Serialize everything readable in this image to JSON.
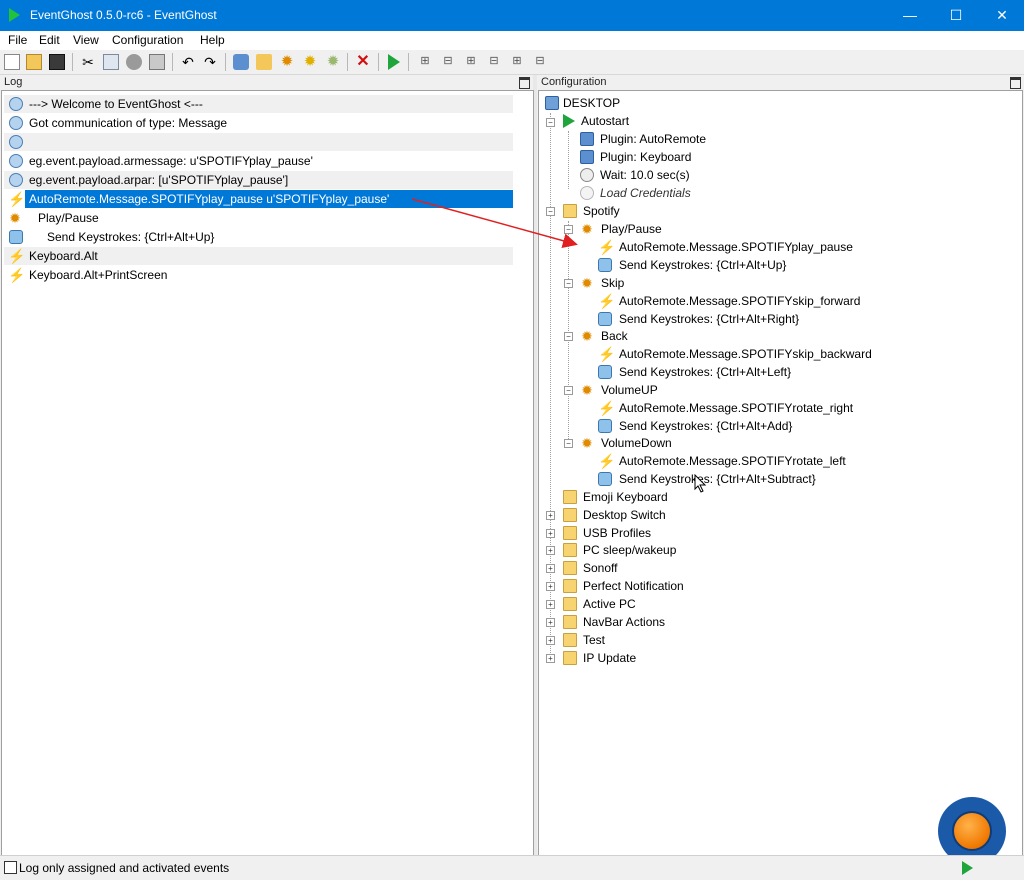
{
  "window": {
    "title": "EventGhost 0.5.0-rc6 - EventGhost",
    "min_label": "—",
    "max_label": "☐",
    "close_label": "✕"
  },
  "menu": [
    "File",
    "Edit",
    "View",
    "Configuration",
    "Help"
  ],
  "toolbar_icons": [
    "new-icon",
    "open-icon",
    "save-icon",
    "cut-icon",
    "copy-icon",
    "python-icon",
    "paste-icon",
    "undo-icon",
    "redo-icon",
    "add-plugin-icon",
    "add-folder-icon",
    "add-macro-icon",
    "add-event-icon",
    "add-action-icon",
    "delete-icon",
    "execute-icon",
    "expand-icon",
    "collapse-icon",
    "expand-children-icon",
    "collapse-children-icon",
    "expand-all-icon",
    "collapse-all-icon"
  ],
  "log": {
    "header": "Log",
    "rows": [
      {
        "icon": "message",
        "text": "---> Welcome to EventGhost <---"
      },
      {
        "icon": "message",
        "text": "Got communication of type: Message"
      },
      {
        "icon": "message",
        "text": ""
      },
      {
        "icon": "message",
        "text": "eg.event.payload.armessage: u'SPOTIFYplay_pause'"
      },
      {
        "icon": "message",
        "text": "eg.event.payload.arpar: [u'SPOTIFYplay_pause']"
      },
      {
        "icon": "event",
        "text": "AutoRemote.Message.SPOTIFYplay_pause u'SPOTIFYplay_pause'"
      },
      {
        "icon": "macro",
        "text": "Play/Pause"
      },
      {
        "icon": "keyboard",
        "text": "Send Keystrokes: {Ctrl+Alt+Up}"
      },
      {
        "icon": "event",
        "text": "Keyboard.Alt"
      },
      {
        "icon": "event",
        "text": "Keyboard.Alt+PrintScreen"
      }
    ],
    "selected_index": 5
  },
  "config": {
    "header": "Configuration",
    "root": "DESKTOP",
    "autostart": {
      "label": "Autostart",
      "items": [
        {
          "icon": "plugin",
          "text": "Plugin: AutoRemote"
        },
        {
          "icon": "plugin",
          "text": "Plugin: Keyboard"
        },
        {
          "icon": "clock",
          "text": "Wait: 10.0 sec(s)"
        },
        {
          "icon": "clock",
          "text": "Load Credentials",
          "disabled": true
        }
      ]
    },
    "spotify": {
      "label": "Spotify",
      "macros": [
        {
          "label": "Play/Pause",
          "event": "AutoRemote.Message.SPOTIFYplay_pause",
          "action": "Send Keystrokes: {Ctrl+Alt+Up}"
        },
        {
          "label": "Skip",
          "event": "AutoRemote.Message.SPOTIFYskip_forward",
          "action": "Send Keystrokes: {Ctrl+Alt+Right}"
        },
        {
          "label": "Back",
          "event": "AutoRemote.Message.SPOTIFYskip_backward",
          "action": "Send Keystrokes: {Ctrl+Alt+Left}"
        },
        {
          "label": "VolumeUP",
          "event": "AutoRemote.Message.SPOTIFYrotate_right",
          "action": "Send Keystrokes: {Ctrl+Alt+Add}"
        },
        {
          "label": "VolumeDown",
          "event": "AutoRemote.Message.SPOTIFYrotate_left",
          "action": "Send Keystrokes: {Ctrl+Alt+Subtract}"
        }
      ]
    },
    "folders": [
      "Emoji Keyboard",
      "Desktop Switch",
      "USB Profiles",
      "PC sleep/wakeup",
      "Sonoff",
      "Perfect Notification",
      "Active PC",
      "NavBar Actions",
      "Test",
      "IP Update"
    ]
  },
  "statusbar": {
    "checkbox_label": "Log only assigned and activated events",
    "checked": false
  },
  "colors": {
    "titlebar": "#0078d7",
    "selection": "#0078d7",
    "arrow": "#e02020"
  }
}
